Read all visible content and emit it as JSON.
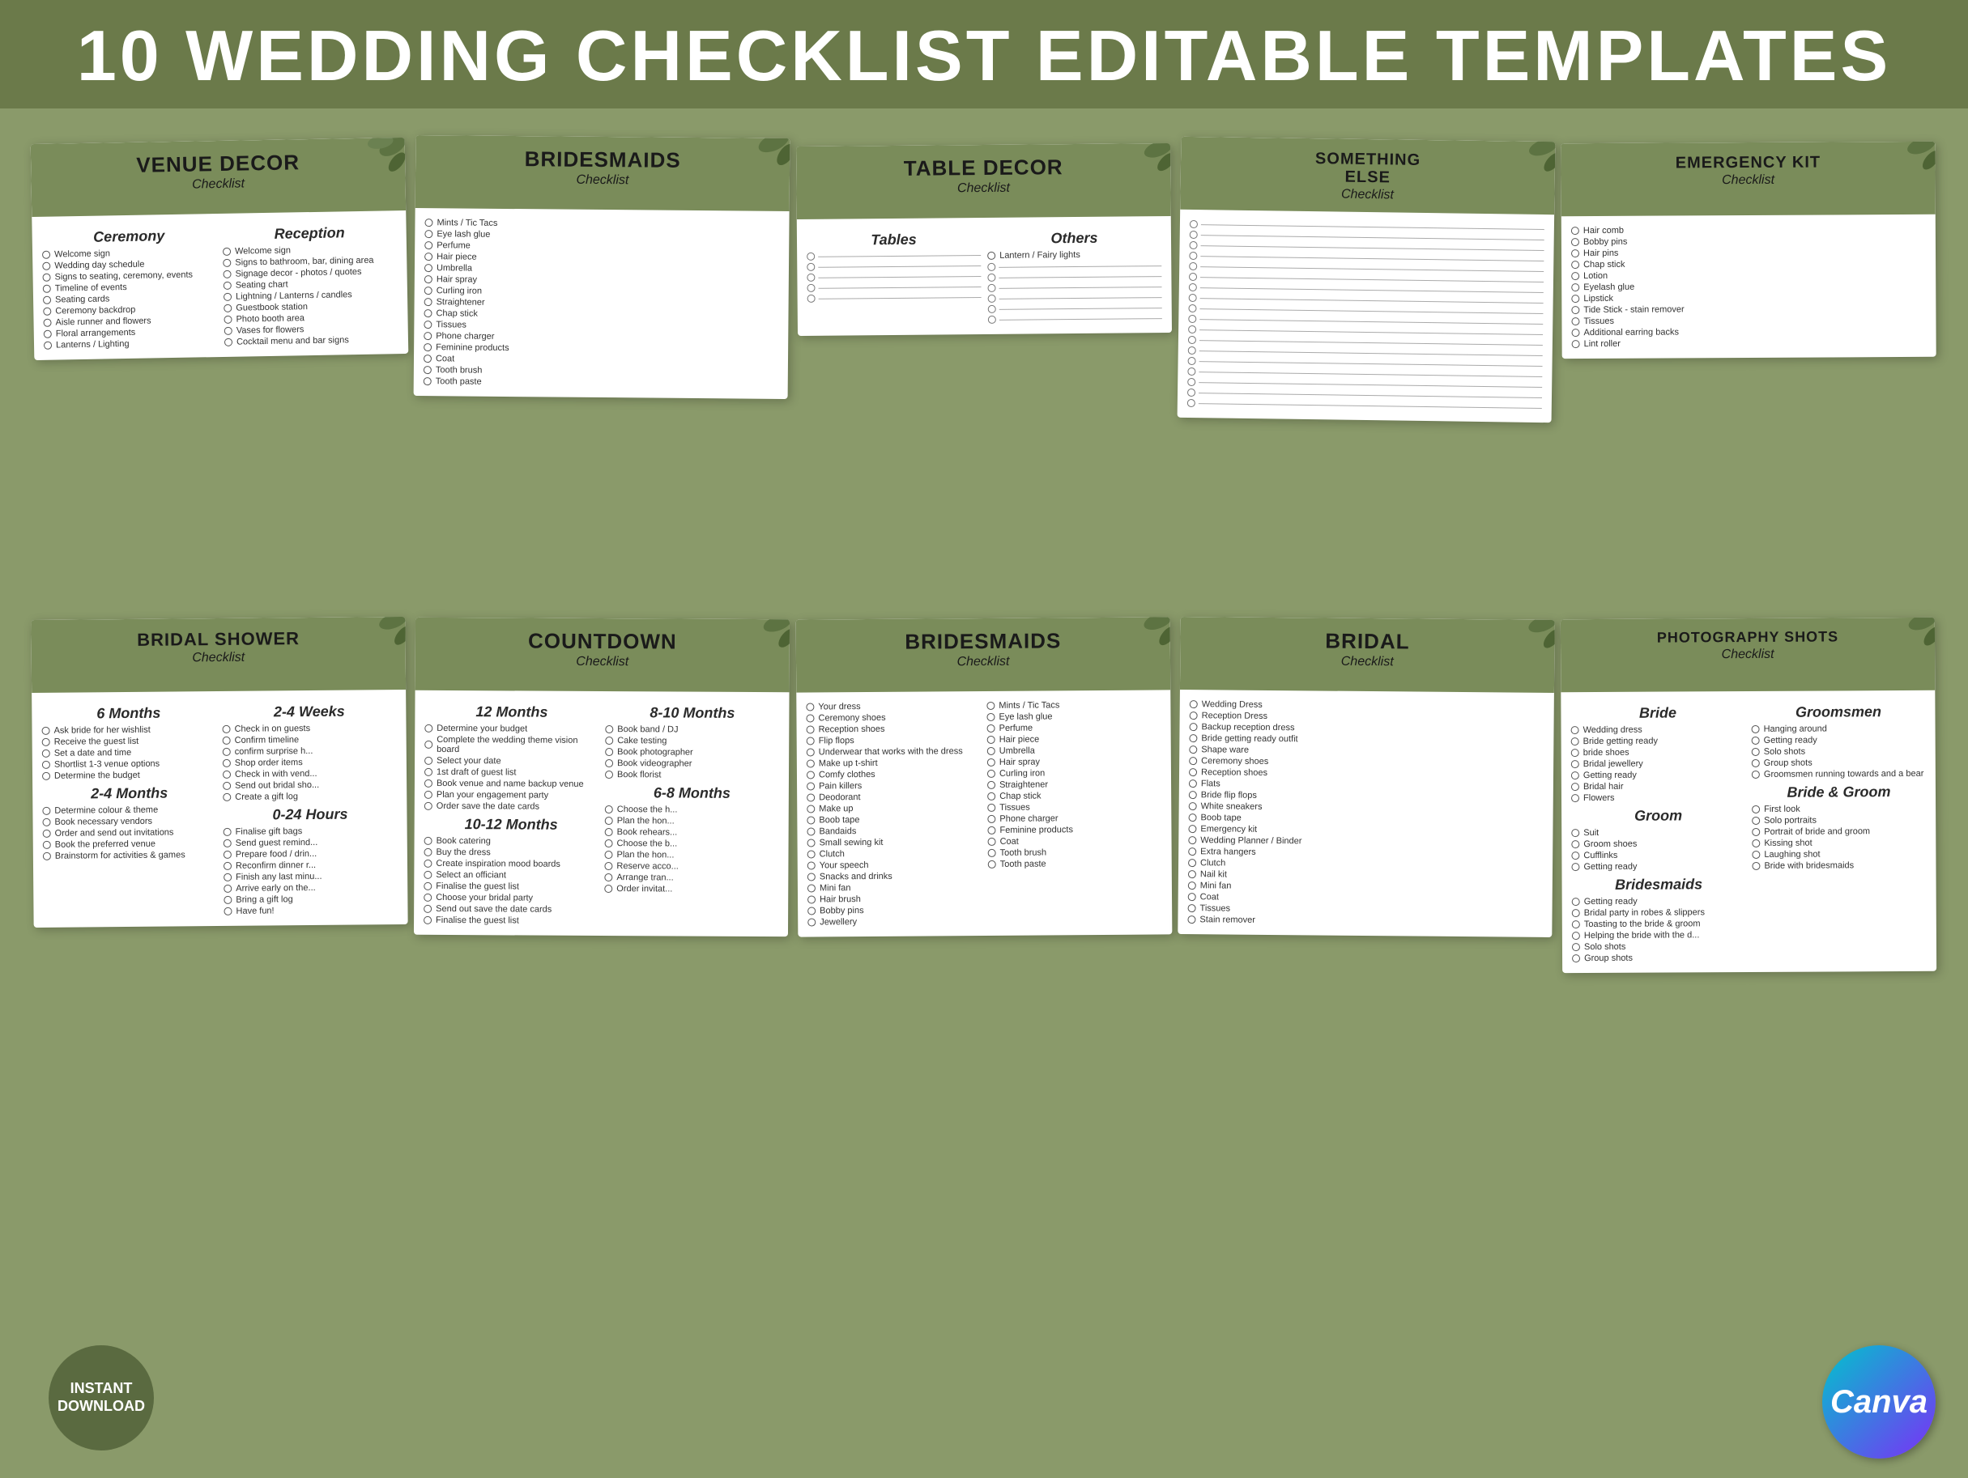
{
  "header": {
    "title": "10 WEDDING CHECKLIST EDITABLE TEMPLATES"
  },
  "badges": {
    "instant_download": "INSTANT\nDOWNLOAD",
    "canva": "Canva"
  },
  "cards": {
    "top_row": [
      {
        "id": "venue-decor",
        "title": "VENUE DECOR",
        "subtitle": "Checklist",
        "sections": [
          {
            "title": "Ceremony",
            "items": [
              "Welcome sign",
              "Wedding day schedule",
              "Signs to seating, ceremony, events",
              "Timeline of events",
              "Seating cards",
              "Ceremony backdrop",
              "Aisle runner and flowers",
              "Floral arrangements",
              "Lanterns / Lighting"
            ]
          },
          {
            "title": "Reception",
            "items": [
              "Welcome sign",
              "Signs to bathroom, bar, dining area",
              "Signage decor - photos / quotes",
              "Seating chart",
              "Lightning / Lanterns / candles",
              "Guestbook station",
              "Photo booth area",
              "Vases for flowers",
              "Cocktail menu and bar signs"
            ]
          }
        ]
      },
      {
        "id": "bridesmaids-1",
        "title": "BRIDESMAIDS",
        "subtitle": "Checklist",
        "items": [
          "Mints / Tic Tacs",
          "Eye lash glue",
          "Perfume",
          "Hair piece",
          "Umbrella",
          "Hair spray",
          "Curling iron",
          "Straightener",
          "Chap stick",
          "Tissues",
          "Phone charger",
          "Feminine products",
          "Coat",
          "Tooth brush",
          "Tooth paste"
        ]
      },
      {
        "id": "table-decor",
        "title": "TABLE DECOR",
        "subtitle": "Checklist",
        "sections": [
          {
            "title": "Tables",
            "items": [
              "(items)",
              "(items)",
              "(items)",
              "(items)",
              "(items)"
            ]
          },
          {
            "title": "Others",
            "items": [
              "Lantern / Fairy lights",
              "(items)",
              "(items)",
              "(items)",
              "(items)",
              "(items)",
              "(items)"
            ]
          }
        ]
      },
      {
        "id": "something-else",
        "title": "SOMETHING ELSE",
        "subtitle": "Checklist",
        "blank_lines": 18
      },
      {
        "id": "emergency-kit",
        "title": "EMERGENCY KIT",
        "subtitle": "Checklist",
        "items": [
          "Hair comb",
          "Bobby pins",
          "Hair pins",
          "Chap stick",
          "Lotion",
          "Eyelash glue",
          "Lipstick",
          "Tide Stick - stain remover",
          "Tissues",
          "Additional earring backs",
          "Lint roller"
        ]
      }
    ],
    "bottom_row": [
      {
        "id": "bridal-shower",
        "title": "BRIDAL SHOWER",
        "subtitle": "Checklist",
        "sections": [
          {
            "title": "6 Months",
            "items": [
              "Ask bride for her wishlist",
              "Receive the guest list",
              "Set a date and time",
              "Shortlist 1-3 venue options",
              "Determine the budget"
            ]
          },
          {
            "title": "2-4 Months",
            "items": [
              "Determine colour & theme",
              "Book necessary vendors",
              "Order and send out invitations",
              "Book the preferred venue",
              "Brainstorm for activities & games"
            ]
          },
          {
            "title": "2-4 Weeks",
            "items": [
              "Check in on guests",
              "Confirm timeline",
              "confirm surprise h...",
              "Shop order items",
              "Check in with vend...",
              "Send out bridal sho...",
              "Create a gift log"
            ]
          },
          {
            "title": "0-24 Hours",
            "items": [
              "Finalise gift bags",
              "Send guest remind...",
              "Prepare food / drin...",
              "Reconfirm dinner r...",
              "Finish any last minu...",
              "Arrive early on the...",
              "Bring a gift log",
              "Have fun!"
            ]
          }
        ]
      },
      {
        "id": "countdown",
        "title": "COUNTDOWN",
        "subtitle": "Checklist",
        "sections": [
          {
            "title": "12 Months",
            "items": [
              "Determine your budget",
              "Complete the wedding theme vision board",
              "Select your date",
              "1st draft of guest list",
              "Book venue and name backup venue",
              "Plan your engagement party",
              "Order save the date cards"
            ]
          },
          {
            "title": "10-12 Months",
            "items": [
              "Book catering",
              "Buy the dress",
              "Create inspiration mood boards",
              "Select an officiant",
              "Finalise the guest list",
              "Choose your bridal party",
              "Send out save the date cards",
              "Finalise the guest list"
            ]
          },
          {
            "title": "8-10 Months",
            "items": [
              "Book band / DJ",
              "Cake testing",
              "Book photographer",
              "Book videographer",
              "Book florist"
            ]
          },
          {
            "title": "6-8 Months",
            "items": [
              "Choose the h...",
              "Plan the hon...",
              "Book rehears...",
              "Choose the b...",
              "Plan the hon...",
              "Reserve acco...",
              "Arrange tran...",
              "Order invitat..."
            ]
          }
        ]
      },
      {
        "id": "bridesmaids-2",
        "title": "BRIDESMAIDS",
        "subtitle": "Checklist",
        "two_cols": [
          {
            "title": "",
            "items": [
              "Your dress",
              "Ceremony shoes",
              "Reception shoes",
              "Flip flops",
              "Underwear that works with the dress",
              "Make up t-shirt",
              "Comfy clothes",
              "Pain killers",
              "Deodorant",
              "Make up",
              "Boob tape",
              "Bandaids",
              "Small sewing kit",
              "Clutch",
              "Your speech",
              "Snacks and drinks",
              "Mini fan",
              "Hair brush",
              "Bobby pins",
              "Jewellery"
            ]
          },
          {
            "title": "",
            "items": [
              "Mints / Tic Tacs",
              "Eye lash glue",
              "Perfume",
              "Hair piece",
              "Umbrella",
              "Hair spray",
              "Curling iron",
              "Straightener",
              "Chap stick",
              "Tissues",
              "Phone charger",
              "Feminine products",
              "Coat",
              "Tooth brush",
              "Tooth paste"
            ]
          }
        ]
      },
      {
        "id": "bridal-bag",
        "title": "BRIDAL",
        "subtitle": "Checklist",
        "items": [
          "Wedding Dress",
          "Reception Dress",
          "Backup reception dress",
          "Bride getting ready outfit",
          "Shape ware",
          "Ceremony shoes",
          "Reception shoes",
          "Flats",
          "Bride flip flops",
          "White sneakers",
          "Boob tape",
          "Emergency kit",
          "Wedding Planner / Binder",
          "Extra hangers",
          "Clutch",
          "Nail kit",
          "Mini fan",
          "Coat",
          "Tissues",
          "Stain remover"
        ]
      },
      {
        "id": "photography-shots",
        "title": "PHOTOGRAPHY SHOTS",
        "subtitle": "Checklist",
        "sections": [
          {
            "title": "Bride",
            "items": [
              "Wedding dress",
              "Bride getting ready",
              "bride shoes",
              "Bridal jewellery",
              "Getting ready",
              "Bridal hair",
              "Flowers"
            ]
          },
          {
            "title": "Groomsmen",
            "items": [
              "Hanging around",
              "Getting ready",
              "Solo shots",
              "Group shots",
              "Groomsmen running towards and a bear"
            ]
          },
          {
            "title": "Groom",
            "items": [
              "Suit",
              "Groom shoes",
              "Cufflinks",
              "Getting ready"
            ]
          },
          {
            "title": "Bride & Groom",
            "items": [
              "First look",
              "Solo portraits",
              "Portrait of bride and groom",
              "Kissing shot",
              "Laughing shot",
              "Bride with bridesmaids"
            ]
          },
          {
            "title": "Bridesmaids",
            "items": [
              "Getting ready",
              "Bridal party in robes & slippers",
              "Toasting to the bride & groom",
              "Helping the bride with the d...",
              "Solo shots",
              "Group shots"
            ]
          }
        ]
      }
    ]
  }
}
